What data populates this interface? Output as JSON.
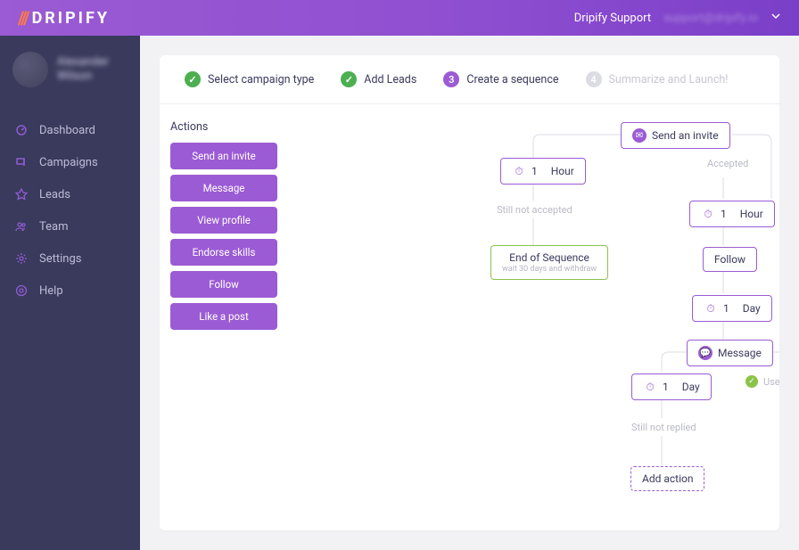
{
  "brand": {
    "mark": "///",
    "text": "DRIPIFY"
  },
  "header": {
    "support_label": "Dripify Support",
    "support_email": "support@dripify.io"
  },
  "profile": {
    "name_line1": "Alexander",
    "name_line2": "Wilson"
  },
  "sidebar": {
    "items": [
      {
        "label": "Dashboard",
        "icon": "dashboard-icon"
      },
      {
        "label": "Campaigns",
        "icon": "campaigns-icon"
      },
      {
        "label": "Leads",
        "icon": "leads-icon"
      },
      {
        "label": "Team",
        "icon": "team-icon"
      },
      {
        "label": "Settings",
        "icon": "settings-icon"
      },
      {
        "label": "Help",
        "icon": "help-icon"
      }
    ]
  },
  "steps": [
    {
      "label": "Select campaign type",
      "state": "done"
    },
    {
      "label": "Add Leads",
      "state": "done"
    },
    {
      "num": "3",
      "label": "Create a sequence",
      "state": "active"
    },
    {
      "num": "4",
      "label": "Summarize and Launch!",
      "state": "muted"
    }
  ],
  "actions_panel": {
    "title": "Actions",
    "chips": [
      "Send an invite",
      "Message",
      "View profile",
      "Endorse skills",
      "Follow",
      "Like a post"
    ]
  },
  "flow": {
    "nodes": {
      "invite": "Send an invite",
      "wait1": {
        "value": "1",
        "unit": "Hour"
      },
      "end": {
        "title": "End of Sequence",
        "sub": "wait 30 days and withdraw"
      },
      "wait2": {
        "value": "1",
        "unit": "Hour"
      },
      "follow": "Follow",
      "wait3": {
        "value": "1",
        "unit": "Day"
      },
      "message": "Message",
      "wait4": {
        "value": "1",
        "unit": "Day"
      },
      "add": "Add action"
    },
    "labels": {
      "accepted": "Accepted",
      "not_accepted": "Still not accepted",
      "not_replied": "Still not replied",
      "user_replied": "User Replied"
    }
  }
}
